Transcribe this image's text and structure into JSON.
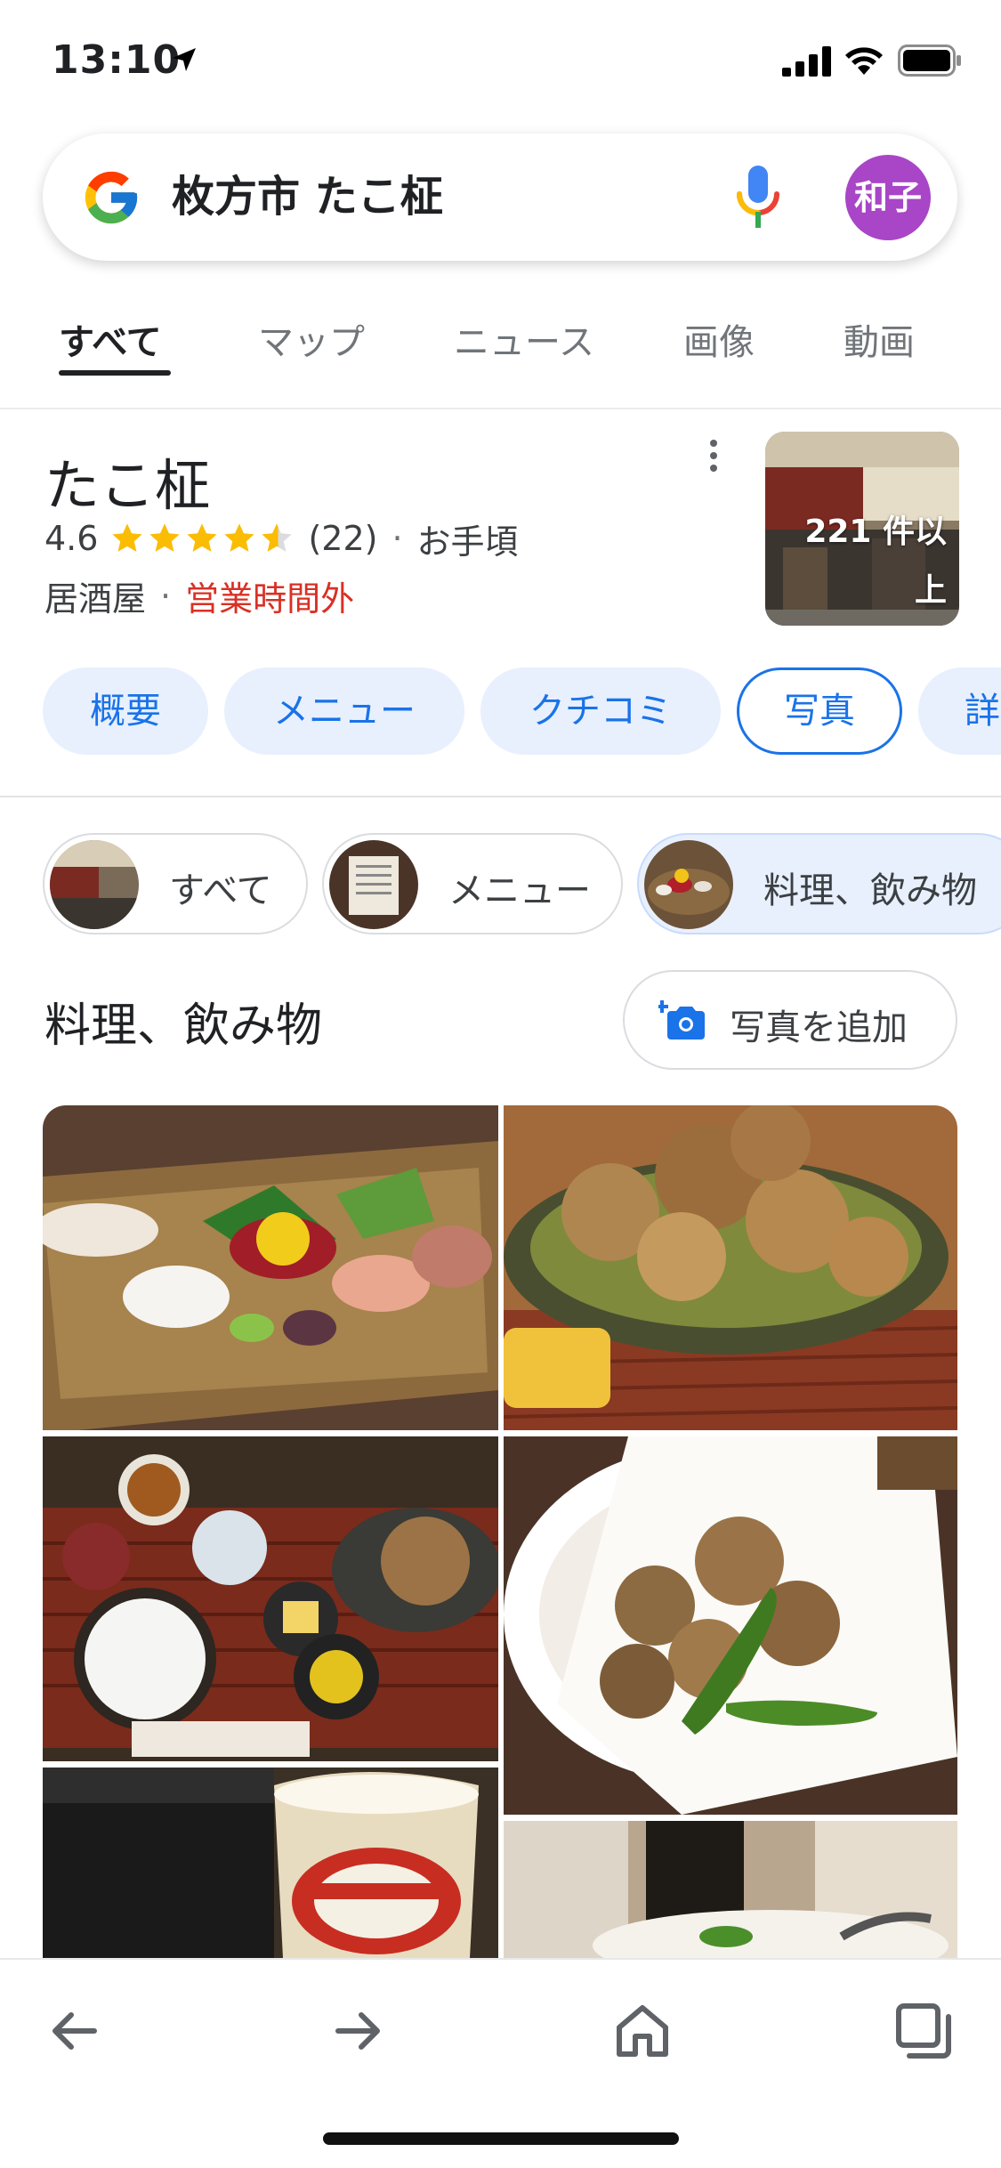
{
  "status_bar": {
    "time": "13:10",
    "icons": [
      "location-arrow-icon",
      "signal-icon",
      "wifi-icon",
      "battery-icon"
    ]
  },
  "search": {
    "query": "枚方市 たこ柾",
    "avatar_label": "和子",
    "avatar_color": "#a846c7"
  },
  "tabs": [
    "すべて",
    "マップ",
    "ニュース",
    "画像",
    "動画"
  ],
  "place": {
    "name": "たこ柾",
    "rating": "4.6",
    "rating_value": 4.6,
    "review_count": "(22)",
    "price": "お手頃",
    "category": "居酒屋",
    "status": "営業時間外",
    "photo_count_line1": "221 件以",
    "photo_count_line2": "上"
  },
  "chips": [
    "概要",
    "メニュー",
    "クチコミ",
    "写真",
    "詳"
  ],
  "photo_filters": [
    "すべて",
    "メニュー",
    "料理、飲み物"
  ],
  "section": {
    "title": "料理、飲み物",
    "add_photo": "写真を追加"
  },
  "colors": {
    "accent": "#1a73e8",
    "chip_bg": "#e8f0fe",
    "closed": "#d93025",
    "star": "#fbbc04"
  },
  "bottom_nav": [
    "back-arrow-icon",
    "forward-arrow-icon",
    "home-icon",
    "tabs-icon"
  ]
}
